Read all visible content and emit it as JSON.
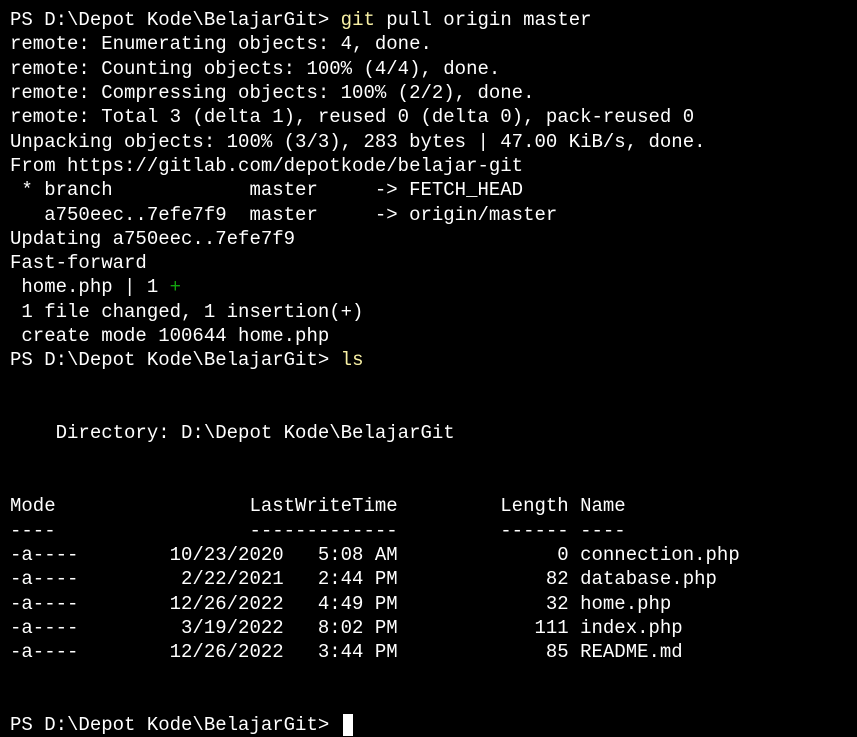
{
  "lines": {
    "0": {
      "prompt": "PS D:\\Depot Kode\\BelajarGit>",
      "cmd": "git",
      "args": "pull origin master"
    },
    "1": "remote: Enumerating objects: 4, done.",
    "2": "remote: Counting objects: 100% (4/4), done.",
    "3": "remote: Compressing objects: 100% (2/2), done.",
    "4": "remote: Total 3 (delta 1), reused 0 (delta 0), pack-reused 0",
    "5": "Unpacking objects: 100% (3/3), 283 bytes | 47.00 KiB/s, done.",
    "6": "From https://gitlab.com/depotkode/belajar-git",
    "7": " * branch            master     -> FETCH_HEAD",
    "8": "   a750eec..7efe7f9  master     -> origin/master",
    "9": "Updating a750eec..7efe7f9",
    "10": "Fast-forward",
    "11": {
      "before": " home.php | 1 ",
      "green": "+"
    },
    "12": " 1 file changed, 1 insertion(+)",
    "13": " create mode 100644 home.php",
    "14": {
      "prompt": "PS D:\\Depot Kode\\BelajarGit>",
      "cmd": "ls"
    },
    "15": "",
    "16": "",
    "17": "    Directory: D:\\Depot Kode\\BelajarGit",
    "18": "",
    "19": "",
    "20": "Mode                 LastWriteTime         Length Name",
    "21": "----                 -------------         ------ ----",
    "22": "-a----        10/23/2020   5:08 AM              0 connection.php",
    "23": "-a----         2/22/2021   2:44 PM             82 database.php",
    "24": "-a----        12/26/2022   4:49 PM             32 home.php",
    "25": "-a----         3/19/2022   8:02 PM            111 index.php",
    "26": "-a----        12/26/2022   3:44 PM             85 README.md",
    "27": "",
    "28": "",
    "29": "PS D:\\Depot Kode\\BelajarGit> "
  }
}
